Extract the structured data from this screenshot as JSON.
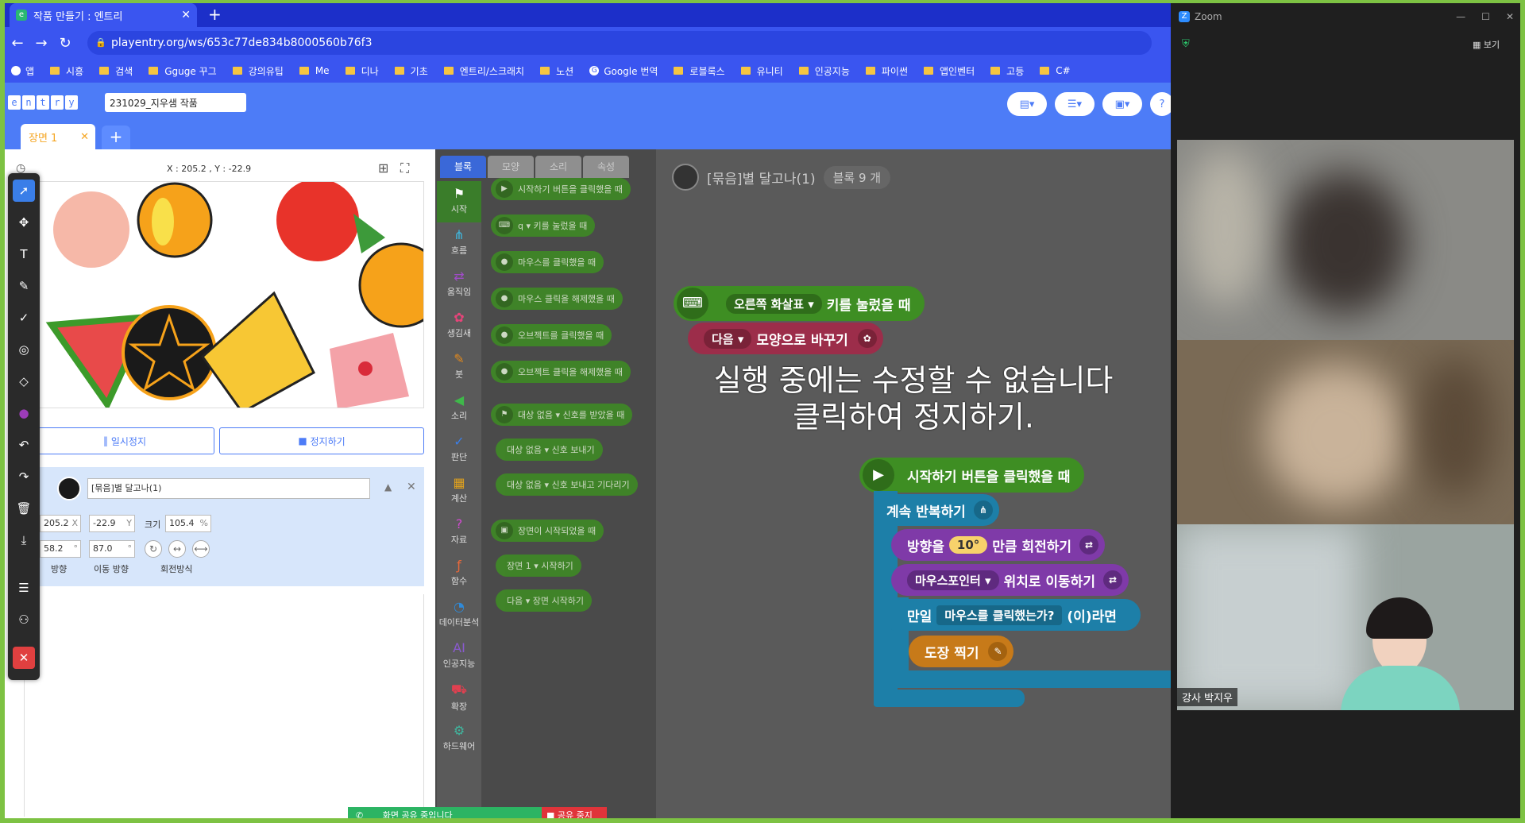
{
  "browser": {
    "tab_title": "작품 만들기 : 엔트리",
    "new_tab": "+",
    "url": "playentry.org/ws/653c77de834b8000560b76f3",
    "bookmarks": [
      "앱",
      "시흥",
      "검색",
      "Gguge 꾸그",
      "강의유팁",
      "Me",
      "디나",
      "기초",
      "엔트리/스크래치",
      "노션",
      "Google 번역",
      "로블록스",
      "유니티",
      "인공지능",
      "파이썬",
      "앱인벤터",
      "고등",
      "C#"
    ]
  },
  "entry": {
    "logo_letters": [
      "e",
      "n",
      "t",
      "r",
      "y"
    ],
    "project_name": "231029_지우샘 작품",
    "scene_tab": "장면 1",
    "scene_add": "+",
    "coords": "X : 205.2 , Y : -22.9",
    "pause_label": "일시정지",
    "stop_label": "정지하기",
    "object": {
      "name": "[묶음]별 달고나(1)",
      "x": "205.2",
      "x_label": "X",
      "y": "-22.9",
      "y_label": "Y",
      "size_label": "크기",
      "size": "105.4",
      "size_unit": "%",
      "direction": "58.2",
      "direction_unit": "°",
      "move_direction": "87.0",
      "move_unit": "°",
      "direction_label": "방향",
      "move_direction_label": "이동 방향",
      "rotation_label": "회전방식"
    },
    "palette_tabs": [
      "블록",
      "모양",
      "소리",
      "속성"
    ],
    "categories": [
      "시작",
      "흐름",
      "움직임",
      "생김새",
      "붓",
      "소리",
      "판단",
      "계산",
      "자료",
      "함수",
      "데이터분석",
      "인공지능",
      "확장",
      "하드웨어"
    ],
    "palette_blocks": [
      {
        "icon": "▶",
        "text": "시작하기 버튼을 클릭했을 때"
      },
      {
        "icon": "⌨",
        "text": "q ▾  키를 눌렀을 때"
      },
      {
        "icon": "●",
        "text": "마우스를 클릭했을 때"
      },
      {
        "icon": "●",
        "text": "마우스 클릭을 해제했을 때"
      },
      {
        "icon": "●",
        "text": "오브젝트를 클릭했을 때"
      },
      {
        "icon": "●",
        "text": "오브젝트 클릭을 해제했을 때"
      },
      {
        "icon": "⚑",
        "text": "대상 없음 ▾  신호를 받았을 때"
      },
      {
        "icon": "",
        "text": "대상 없음 ▾  신호 보내기"
      },
      {
        "icon": "",
        "text": "대상 없음 ▾  신호 보내고 기다리기"
      },
      {
        "icon": "▣",
        "text": "장면이 시작되었을 때"
      },
      {
        "icon": "",
        "text": "장면 1 ▾  시작하기"
      },
      {
        "icon": "",
        "text": "다음 ▾  장면 시작하기"
      }
    ],
    "workspace": {
      "object_title": "[묶음]별 달고나(1)",
      "block_count": "블록 9 개",
      "key_event": "키를 눌렀을 때",
      "key_name": "오른쪽 화살표 ▾",
      "shape_next": "다음 ▾",
      "shape_change": "모양으로 바꾸기",
      "overlay_line1": "실행 중에는 수정할 수 없습니다",
      "overlay_line2": "클릭하여 정지하기.",
      "start_event": "시작하기 버튼을 클릭했을 때",
      "repeat": "계속 반복하기",
      "rotate_pre": "방향을",
      "rotate_value": "10°",
      "rotate_post": "만큼 회전하기",
      "move_target": "마우스포인터 ▾",
      "move_post": "위치로 이동하기",
      "if_label": "만일",
      "if_cond": "마우스를 클릭했는가?",
      "if_post": "(이)라면",
      "stamp": "도장 찍기"
    },
    "share_status": "화면 공유 중입니다",
    "share_stop": "공유 중지"
  },
  "zoom": {
    "app_title": "Zoom",
    "view_label": "보기",
    "participant_name": "강사 박지우"
  },
  "colors": {
    "entry_blue": "#4d7cf7",
    "start_green": "#3e8e23",
    "flow_teal": "#1d9cc4",
    "move_purple": "#a04cc8",
    "pen_orange": "#e2891c",
    "frame_green": "#7dc243"
  }
}
